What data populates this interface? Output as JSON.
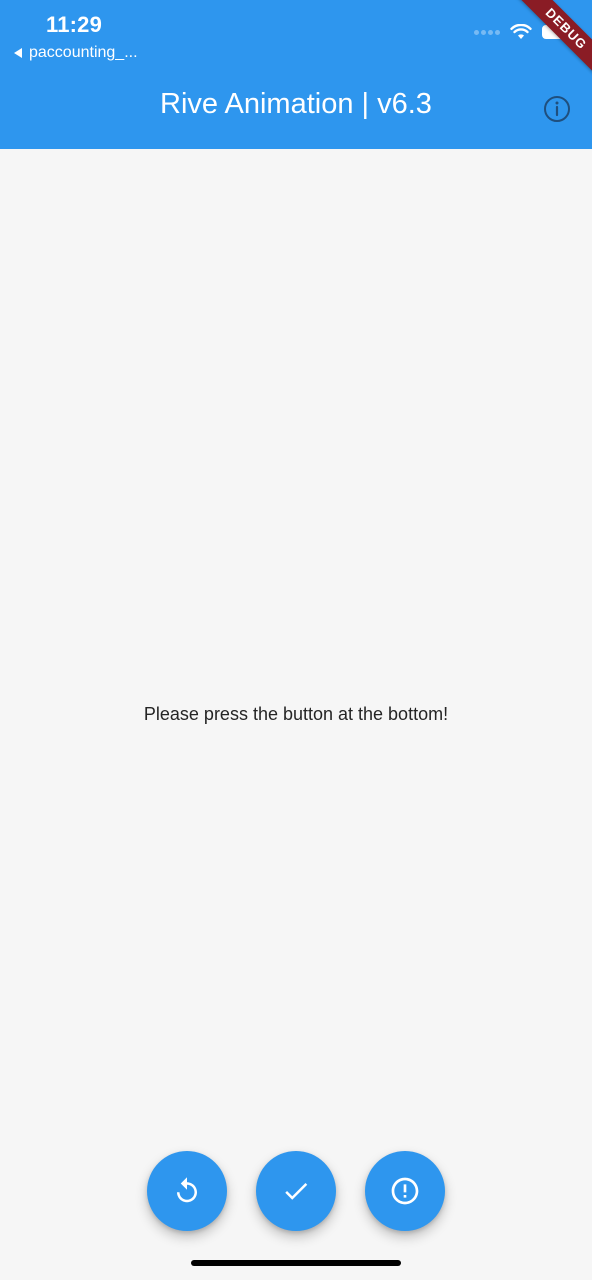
{
  "status_bar": {
    "time": "11:29",
    "back_app": "paccounting_..."
  },
  "app_bar": {
    "title": "Rive Animation | v6.3",
    "info_icon": "info-icon",
    "debug_banner": "DEBUG"
  },
  "body": {
    "message": "Please press the button at the bottom!"
  },
  "actions": [
    {
      "icon": "replay-icon"
    },
    {
      "icon": "check-icon"
    },
    {
      "icon": "error-outline-icon"
    }
  ],
  "colors": {
    "primary": "#2e96ee",
    "background": "#f6f6f6",
    "debug_banner": "#8a1c25"
  }
}
